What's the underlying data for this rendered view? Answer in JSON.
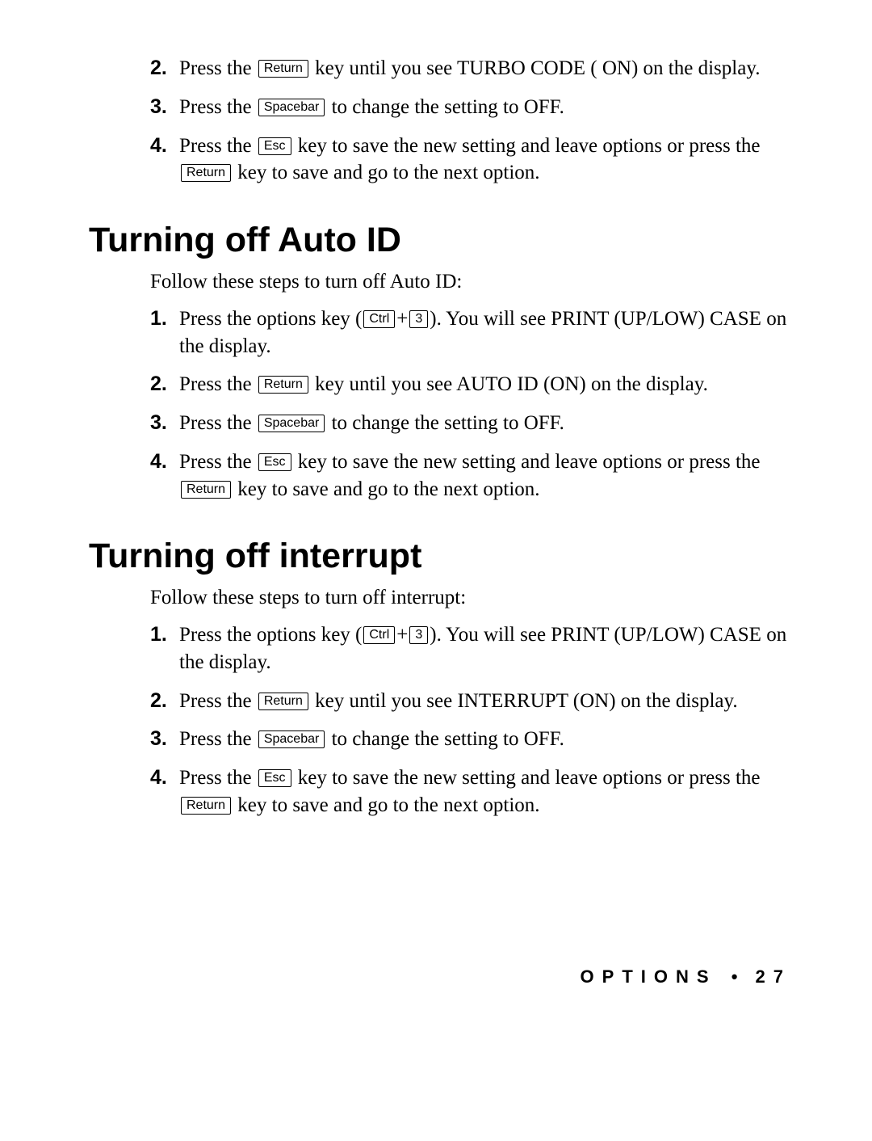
{
  "keys": {
    "return": "Return",
    "spacebar": "Spacebar",
    "esc": "Esc",
    "ctrl": "Ctrl",
    "three": "3"
  },
  "section_a": {
    "steps": [
      {
        "num": "2.",
        "t1": "Press the ",
        "k1": "return",
        "t2": " key until you see TURBO CODE ( ON) on the display."
      },
      {
        "num": "3.",
        "t1": "Press the ",
        "k1": "spacebar",
        "t2": " to change the setting to OFF."
      },
      {
        "num": "4.",
        "t1": "Press the ",
        "k1": "esc",
        "t2": " key to save the new setting and leave options or press the ",
        "k2": "return",
        "t3": " key to save and go to the next option."
      }
    ]
  },
  "section_b": {
    "heading": "Turning off Auto ID",
    "intro": "Follow these steps to turn off Auto ID:",
    "steps": [
      {
        "num": "1.",
        "t1": "Press the options key (",
        "k1": "ctrl",
        "plus": "+",
        "k2": "three",
        "t2": "). You will see PRINT (UP/LOW) CASE on the display."
      },
      {
        "num": "2.",
        "t1": "Press the ",
        "k1": "return",
        "t2": " key until you see AUTO ID (ON) on the display."
      },
      {
        "num": "3.",
        "t1": "Press the ",
        "k1": "spacebar",
        "t2": " to change the setting to OFF."
      },
      {
        "num": "4.",
        "t1": "Press the ",
        "k1": "esc",
        "t2": " key to save the new setting and leave options or press the ",
        "k2": "return",
        "t3": " key to save and go to the next option."
      }
    ]
  },
  "section_c": {
    "heading": "Turning off interrupt",
    "intro": "Follow these steps to turn off interrupt:",
    "steps": [
      {
        "num": "1.",
        "t1": "Press the options key (",
        "k1": "ctrl",
        "plus": "+",
        "k2": "three",
        "t2": "). You will see PRINT (UP/LOW) CASE on the display."
      },
      {
        "num": "2.",
        "t1": "Press the ",
        "k1": "return",
        "t2": " key until you see INTERRUPT (ON) on the display."
      },
      {
        "num": "3.",
        "t1": "Press the ",
        "k1": "spacebar",
        "t2": " to change the setting to OFF."
      },
      {
        "num": "4.",
        "t1": "Press the ",
        "k1": "esc",
        "t2": " key to save the new setting and leave options or press the ",
        "k2": "return",
        "t3": " key to save and go to the next option."
      }
    ]
  },
  "footer": {
    "label": "OPTIONS",
    "dot": "•",
    "page": "27"
  }
}
